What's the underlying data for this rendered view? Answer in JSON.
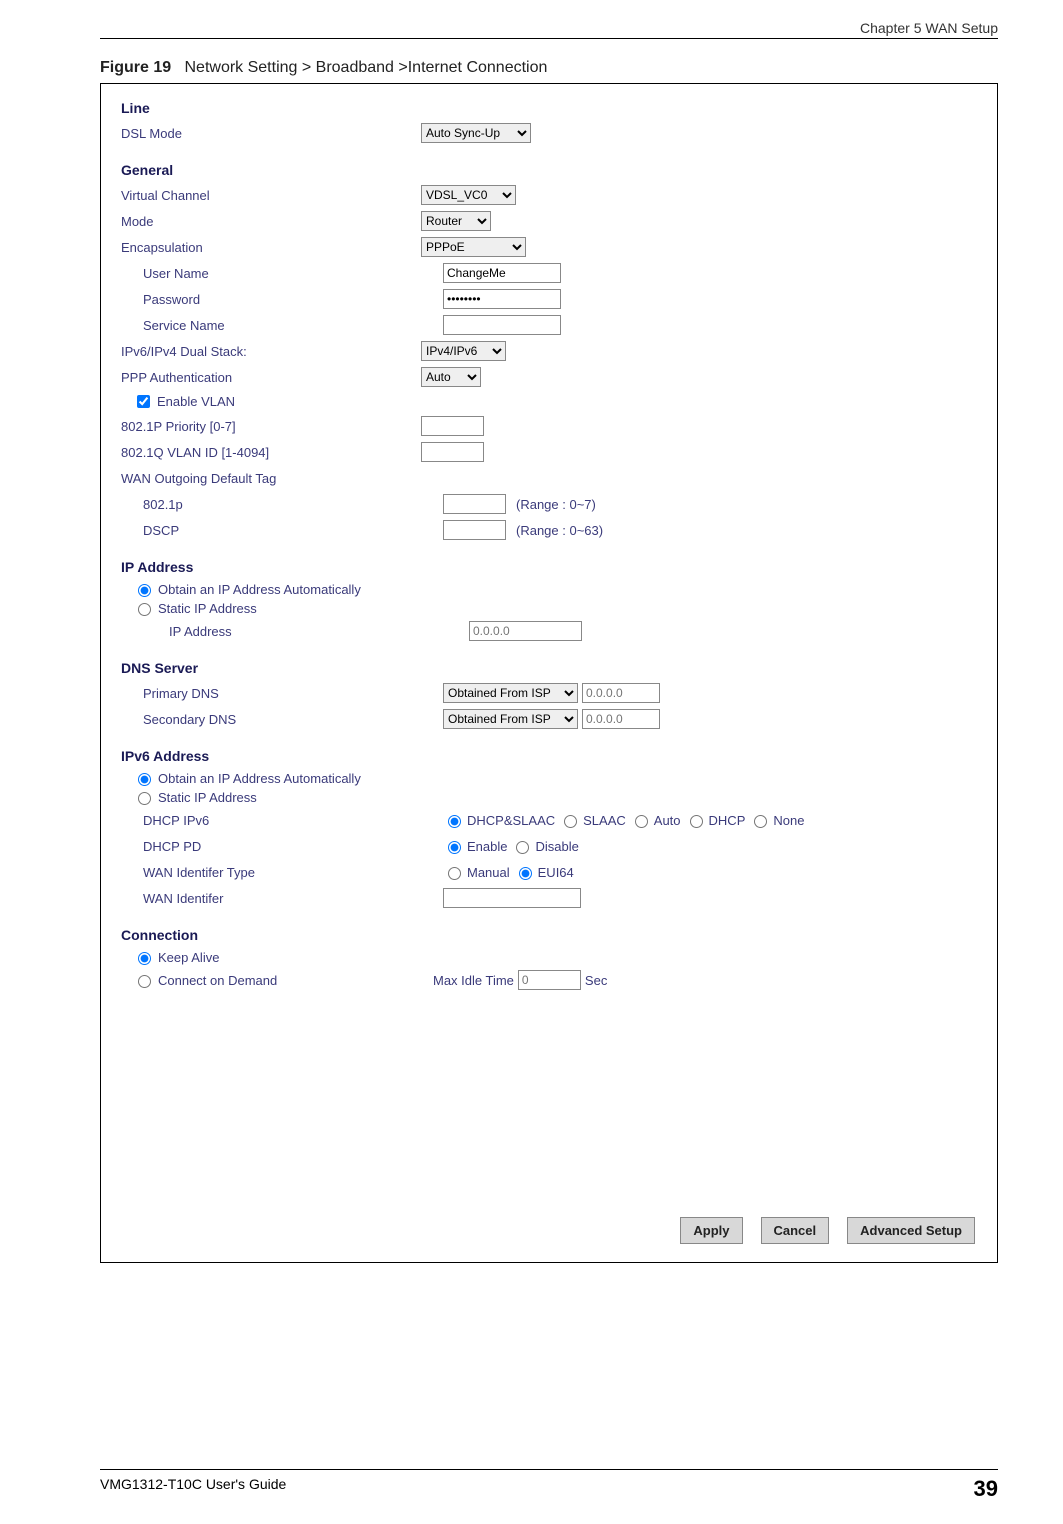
{
  "header": {
    "chapter": "Chapter 5 WAN Setup"
  },
  "figure": {
    "num": "Figure 19",
    "caption": "Network Setting > Broadband >Internet Connection"
  },
  "line": {
    "title": "Line",
    "dsl_mode_label": "DSL Mode",
    "dsl_mode_value": "Auto Sync-Up"
  },
  "general": {
    "title": "General",
    "vc_label": "Virtual Channel",
    "vc_value": "VDSL_VC0",
    "mode_label": "Mode",
    "mode_value": "Router",
    "encap_label": "Encapsulation",
    "encap_value": "PPPoE",
    "user_label": "User Name",
    "user_value": "ChangeMe",
    "pass_label": "Password",
    "pass_value": "••••••••",
    "svc_label": "Service Name",
    "svc_value": "",
    "stack_label": "IPv6/IPv4 Dual Stack:",
    "stack_value": "IPv4/IPv6",
    "pppauth_label": "PPP Authentication",
    "pppauth_value": "Auto",
    "vlan_check": "Enable VLAN",
    "prio_label": "802.1P Priority [0-7]",
    "vlanid_label": "802.1Q VLAN ID [1-4094]",
    "wantag_label": "WAN Outgoing Default Tag",
    "p8021_label": "802.1p",
    "p8021_hint": "(Range : 0~7)",
    "dscp_label": "DSCP",
    "dscp_hint": "(Range : 0~63)"
  },
  "ip": {
    "title": "IP Address",
    "auto": "Obtain an IP Address Automatically",
    "static": "Static IP Address",
    "ipaddr_label": "IP Address",
    "ipaddr_ph": "0.0.0.0"
  },
  "dns": {
    "title": "DNS Server",
    "primary_label": "Primary DNS",
    "primary_value": "Obtained From ISP",
    "primary_ph": "0.0.0.0",
    "secondary_label": "Secondary DNS",
    "secondary_value": "Obtained From ISP",
    "secondary_ph": "0.0.0.0"
  },
  "ipv6": {
    "title": "IPv6 Address",
    "auto": "Obtain an IP Address Automatically",
    "static": "Static IP Address",
    "dhcp6_label": "DHCP IPv6",
    "dhcp6_opts": [
      "DHCP&SLAAC",
      "SLAAC",
      "Auto",
      "DHCP",
      "None"
    ],
    "pd_label": "DHCP PD",
    "pd_opts": [
      "Enable",
      "Disable"
    ],
    "wanid_type_label": "WAN Identifer Type",
    "wanid_type_opts": [
      "Manual",
      "EUI64"
    ],
    "wanid_label": "WAN Identifer"
  },
  "conn": {
    "title": "Connection",
    "keep": "Keep Alive",
    "cod": "Connect on Demand",
    "idle_label": "Max Idle Time",
    "idle_value": "0",
    "idle_unit": "Sec"
  },
  "buttons": {
    "apply": "Apply",
    "cancel": "Cancel",
    "adv": "Advanced Setup"
  },
  "footer": {
    "guide": "VMG1312-T10C User's Guide",
    "page": "39"
  }
}
